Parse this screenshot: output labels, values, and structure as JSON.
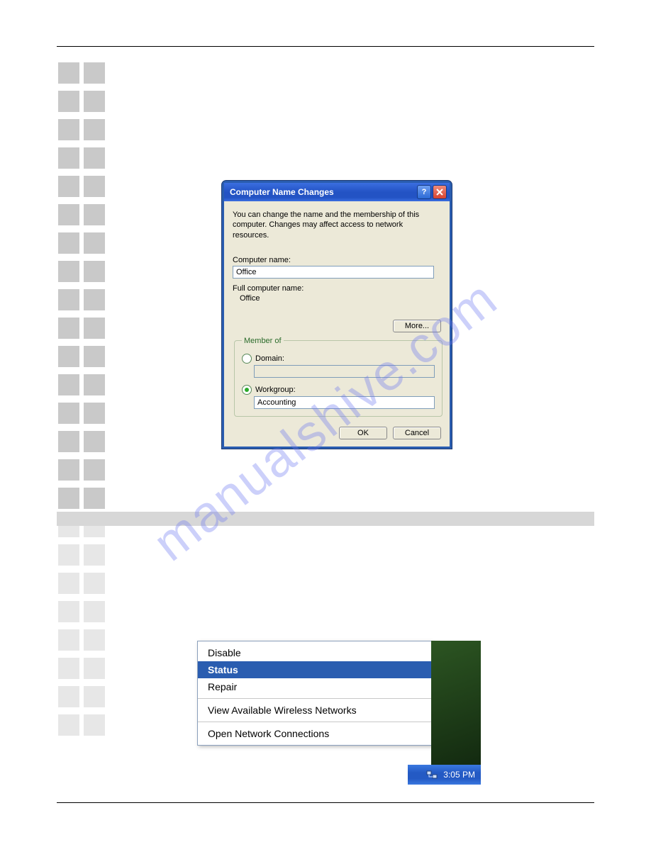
{
  "watermark": "manualshive.com",
  "dialog": {
    "title": "Computer Name Changes",
    "description": "You can change the name and the membership of this computer. Changes may affect access to network resources.",
    "computer_name_label": "Computer name:",
    "computer_name_value": "Office",
    "full_name_label": "Full computer name:",
    "full_name_value": "Office",
    "more_button": "More...",
    "member_of_legend": "Member of",
    "domain_label": "Domain:",
    "domain_value": "",
    "workgroup_label": "Workgroup:",
    "workgroup_value": "Accounting",
    "ok_button": "OK",
    "cancel_button": "Cancel"
  },
  "context_menu": {
    "items": {
      "disable": "Disable",
      "status": "Status",
      "repair": "Repair",
      "view_networks": "View Available Wireless Networks",
      "open_connections": "Open Network Connections"
    }
  },
  "taskbar": {
    "clock": "3:05 PM"
  }
}
